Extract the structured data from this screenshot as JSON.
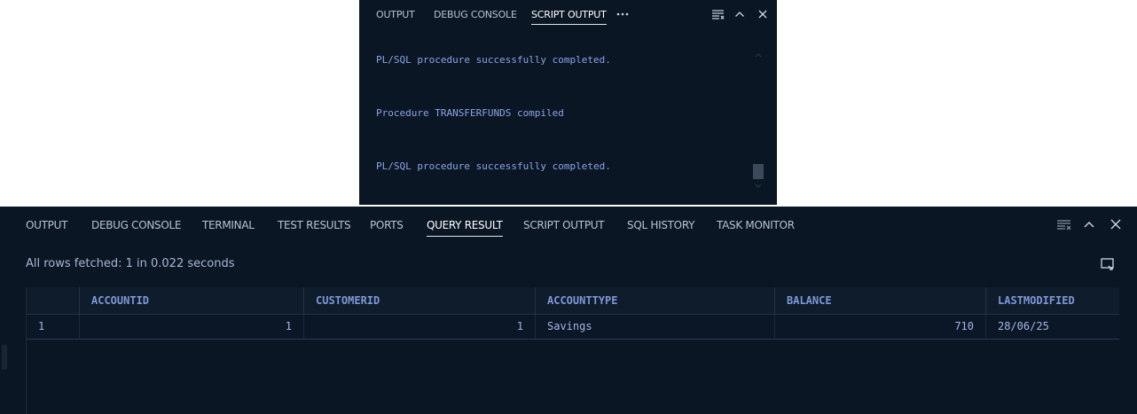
{
  "top_panel": {
    "tabs": [
      {
        "label": "OUTPUT",
        "active": false
      },
      {
        "label": "DEBUG CONSOLE",
        "active": false
      },
      {
        "label": "SCRIPT OUTPUT",
        "active": true
      }
    ],
    "overflow_icon": "ellipsis-icon",
    "messages": [
      "PL/SQL procedure successfully completed.",
      "Procedure TRANSFERFUNDS compiled",
      "PL/SQL procedure successfully completed."
    ]
  },
  "bottom_panel": {
    "tabs": [
      {
        "label": "OUTPUT",
        "active": false
      },
      {
        "label": "DEBUG CONSOLE",
        "active": false
      },
      {
        "label": "TERMINAL",
        "active": false
      },
      {
        "label": "TEST RESULTS",
        "active": false
      },
      {
        "label": "PORTS",
        "active": false
      },
      {
        "label": "QUERY RESULT",
        "active": true
      },
      {
        "label": "SCRIPT OUTPUT",
        "active": false
      },
      {
        "label": "SQL HISTORY",
        "active": false
      },
      {
        "label": "TASK MONITOR",
        "active": false
      }
    ],
    "status": "All rows fetched: 1 in 0.022 seconds",
    "table": {
      "columns": [
        "",
        "ACCOUNTID",
        "CUSTOMERID",
        "ACCOUNTTYPE",
        "BALANCE",
        "LASTMODIFIED"
      ],
      "rows": [
        [
          "1",
          "1",
          "1",
          "Savings",
          "710",
          "28/06/25"
        ]
      ]
    }
  },
  "colors": {
    "panel_bg": "#0a1624",
    "header_bg": "#0f1c2c",
    "accent_text": "#8aa4e8",
    "header_text": "#7f97d6"
  },
  "icons": [
    "clear-output-icon",
    "chevron-up-icon",
    "close-icon",
    "export-icon",
    "ellipsis-icon"
  ]
}
